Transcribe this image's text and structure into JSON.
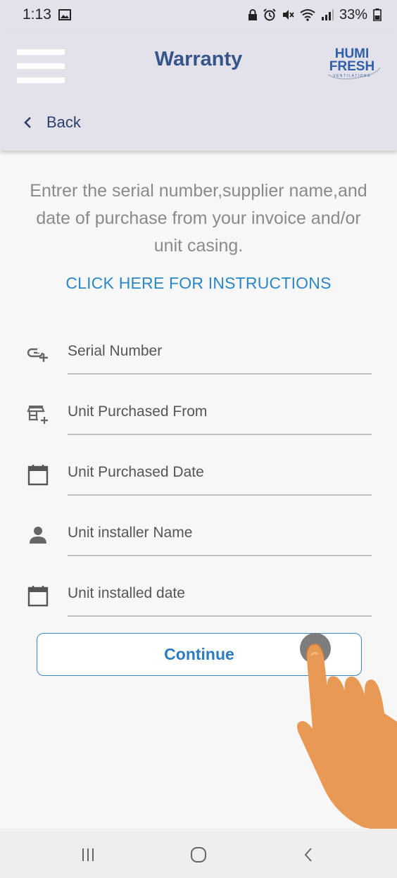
{
  "status_bar": {
    "time": "1:13",
    "battery": "33%",
    "icons": [
      "gallery-icon",
      "lock-icon",
      "alarm-icon",
      "mute-icon",
      "wifi-icon",
      "signal-icon",
      "battery-icon"
    ]
  },
  "header": {
    "title": "Warranty",
    "back_label": "Back",
    "logo_top": "HUMI",
    "logo_bottom": "FRESH",
    "logo_tag": "VENTILATIONS"
  },
  "intro_text": "Entrer the serial number,supplier name,and date of purchase from your invoice and/or unit casing.",
  "instructions_link": "CLICK HERE FOR INSTRUCTIONS",
  "fields": [
    {
      "label": "Serial Number",
      "icon": "link-add-icon"
    },
    {
      "label": "Unit Purchased From",
      "icon": "store-add-icon"
    },
    {
      "label": "Unit Purchased Date",
      "icon": "calendar-icon"
    },
    {
      "label": "Unit installer Name",
      "icon": "person-icon"
    },
    {
      "label": "Unit installed date",
      "icon": "calendar-icon"
    }
  ],
  "continue_label": "Continue",
  "colors": {
    "header_bg": "#e3e2ea",
    "title": "#34548a",
    "link": "#2b87c7",
    "button_border": "#3b86c7"
  }
}
